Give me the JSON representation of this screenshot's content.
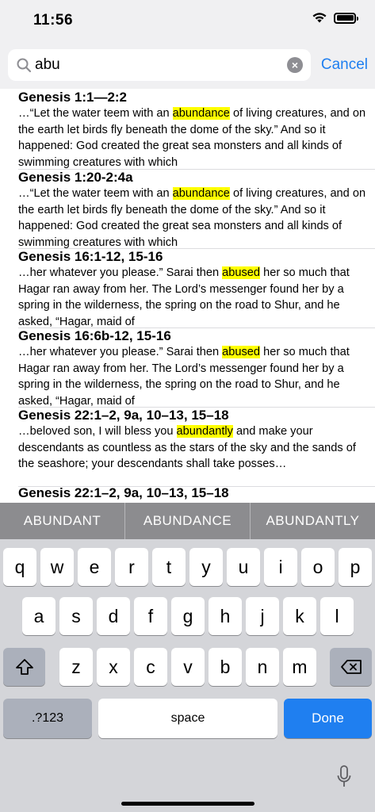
{
  "status": {
    "time": "11:56"
  },
  "search": {
    "query": "abu",
    "cancel_label": "Cancel"
  },
  "results": [
    {
      "ref": "Genesis 1:1—2:2",
      "before": "…“Let the water teem with an ",
      "match": "abundance",
      "after": " of living creatures, and on the earth let birds fly beneath the dome of the sky.” And so it happened: God created the great sea monsters and all kinds of swimming creatures with which"
    },
    {
      "ref": "Genesis 1:20-2:4a",
      "before": "…“Let the water teem with an ",
      "match": "abundance",
      "after": " of living creatures, and on the earth let birds fly beneath the dome of the sky.” And so it happened: God created the great sea monsters and all kinds of swimming creatures with which"
    },
    {
      "ref": "Genesis 16:1-12, 15-16",
      "before": "…her whatever you please.” Sarai then ",
      "match": "abused",
      "after": " her so much that Hagar ran away from her. The Lord’s messenger found her by a spring in the wilderness, the spring on the road to Shur, and he asked, “Hagar, maid of"
    },
    {
      "ref": "Genesis 16:6b-12, 15-16",
      "before": "…her whatever you please.” Sarai then ",
      "match": "abused",
      "after": " her so much that Hagar ran away from her. The Lord’s messenger found her by a spring in the wilderness, the spring on the road to Shur, and he asked, “Hagar, maid of"
    },
    {
      "ref": "Genesis 22:1–2, 9a, 10–13, 15–18",
      "before": "…beloved son, I will bless you ",
      "match": "abundantly",
      "after": " and make your descendants as countless as the stars of the sky and the sands of the seashore; your descendants shall take posses…"
    },
    {
      "ref": "Genesis 22:1–2, 9a, 10–13, 15–18"
    }
  ],
  "suggestions": [
    "ABUNDANT",
    "ABUNDANCE",
    "ABUNDANTLY"
  ],
  "keyboard": {
    "row1": [
      "q",
      "w",
      "e",
      "r",
      "t",
      "y",
      "u",
      "i",
      "o",
      "p"
    ],
    "row2": [
      "a",
      "s",
      "d",
      "f",
      "g",
      "h",
      "j",
      "k",
      "l"
    ],
    "row3": [
      "z",
      "x",
      "c",
      "v",
      "b",
      "n",
      "m"
    ],
    "numbers_label": ".?123",
    "space_label": "space",
    "done_label": "Done"
  },
  "colors": {
    "accent": "#1f7ff0",
    "highlight": "#ffff00"
  }
}
